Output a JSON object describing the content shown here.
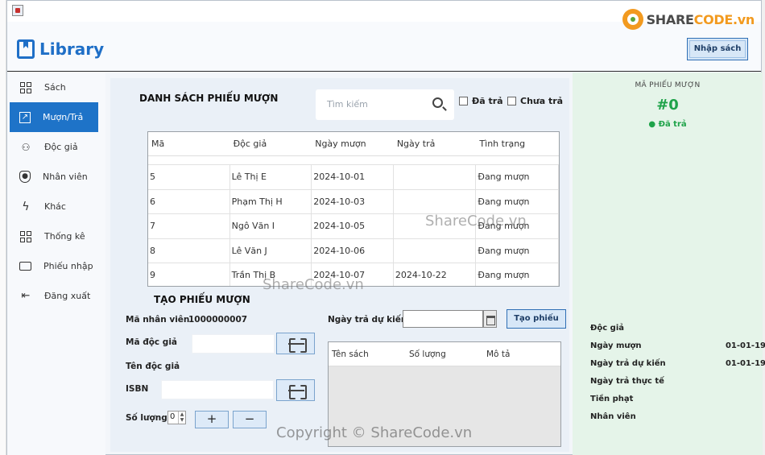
{
  "app": {
    "logo_text": "Library",
    "import_button": "Nhập sách",
    "window_controls": {
      "minimize": "—",
      "maximize": "☐",
      "close": "✕"
    }
  },
  "sidebar": {
    "items": [
      {
        "label": "Sách",
        "icon": "dashboard-grid-icon",
        "active": false
      },
      {
        "label": "Mượn/Trả",
        "icon": "external-link-icon",
        "active": true
      },
      {
        "label": "Độc giả",
        "icon": "readers-icon",
        "active": false
      },
      {
        "label": "Nhân viên",
        "icon": "user-badge-icon",
        "active": false
      },
      {
        "label": "Khác",
        "icon": "bolt-icon",
        "active": false
      },
      {
        "label": "Thống kê",
        "icon": "stats-grid-icon",
        "active": false
      },
      {
        "label": "Phiếu nhập",
        "icon": "ticket-icon",
        "active": false
      },
      {
        "label": "Đăng xuất",
        "icon": "logout-icon",
        "active": false
      }
    ]
  },
  "loans": {
    "title": "DANH SÁCH PHIẾU MƯỢN",
    "search_placeholder": "Tìm kiếm",
    "filter_returned": "Đã trả",
    "filter_not_returned": "Chưa trả",
    "columns": [
      "Mã",
      "Độc giả",
      "Ngày mượn",
      "Ngày trả",
      "Tình trạng"
    ],
    "rows": [
      [
        "5",
        "Lê Thị E",
        "2024-10-01",
        "",
        "Đang mượn"
      ],
      [
        "6",
        "Phạm Thị H",
        "2024-10-03",
        "",
        "Đang mượn"
      ],
      [
        "7",
        "Ngô Văn I",
        "2024-10-05",
        "",
        "Đang mượn"
      ],
      [
        "8",
        "Lê Văn J",
        "2024-10-06",
        "",
        "Đang mượn"
      ],
      [
        "9",
        "Trần Thị B",
        "2024-10-07",
        "2024-10-22",
        "Đang mượn"
      ]
    ]
  },
  "create_form": {
    "title": "TẠO PHIẾU MƯỢN",
    "staff_id_label": "Mã nhân viên",
    "staff_id_value": "1000000007",
    "reader_id_label": "Mã độc giả",
    "reader_name_label": "Tên độc giả",
    "isbn_label": "ISBN",
    "quantity_label": "Số lượng",
    "quantity_value": "0",
    "plus": "+",
    "minus": "−",
    "due_date_label": "Ngày trả dự kiến",
    "create_button": "Tạo phiếu",
    "book_columns": [
      "Tên sách",
      "Số lượng",
      "Mô tả"
    ]
  },
  "detail": {
    "title": "MÃ PHIẾU MƯỢN",
    "id": "#0",
    "status": "● Đã trả",
    "fields": [
      {
        "label": "Độc giả",
        "value": ""
      },
      {
        "label": "Ngày mượn",
        "value": "01-01-19"
      },
      {
        "label": "Ngày trả dự kiến",
        "value": "01-01-19"
      },
      {
        "label": "Ngày trả thực tế",
        "value": ""
      },
      {
        "label": "Tiền phạt",
        "value": ""
      },
      {
        "label": "Nhân viên",
        "value": ""
      }
    ]
  },
  "watermarks": {
    "brand_left": "SHARE",
    "brand_right": "CODE.vn",
    "mark1": "ShareCode.vn",
    "mark2": "ShareCode.vn",
    "copyright": "Copyright © ShareCode.vn"
  },
  "colors": {
    "accent": "#1e73c8",
    "success": "#1fa34a",
    "right_panel_bg": "#e5f4e9"
  }
}
